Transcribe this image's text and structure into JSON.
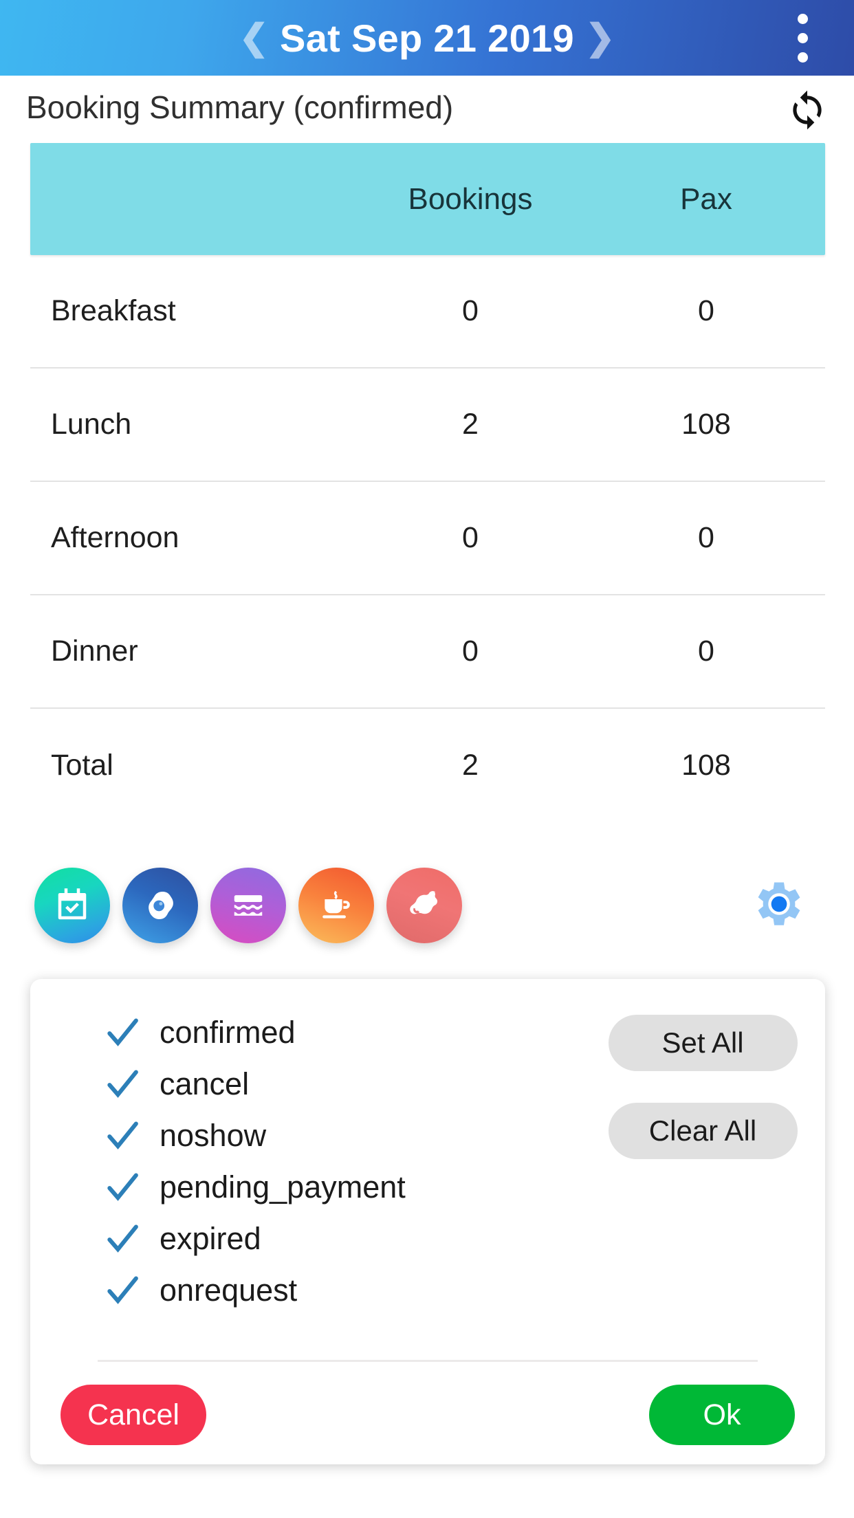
{
  "appbar": {
    "prev_label": "❮",
    "date": "Sat Sep 21 2019",
    "next_label": "❯",
    "overflow_name": "more-options"
  },
  "section": {
    "title": "Booking Summary (confirmed)",
    "refresh_name": "refresh-icon"
  },
  "table": {
    "columns": [
      "",
      "Bookings",
      "Pax"
    ],
    "rows": [
      {
        "name": "Breakfast",
        "bookings": "0",
        "pax": "0"
      },
      {
        "name": "Lunch",
        "bookings": "2",
        "pax": "108"
      },
      {
        "name": "Afternoon",
        "bookings": "0",
        "pax": "0"
      },
      {
        "name": "Dinner",
        "bookings": "0",
        "pax": "0"
      },
      {
        "name": "Total",
        "bookings": "2",
        "pax": "108"
      }
    ]
  },
  "meal_icons": [
    {
      "name": "calendar-check-icon",
      "label": "All bookings"
    },
    {
      "name": "fried-egg-icon",
      "label": "Breakfast"
    },
    {
      "name": "sandwich-icon",
      "label": "Lunch"
    },
    {
      "name": "coffee-cup-icon",
      "label": "Afternoon"
    },
    {
      "name": "chicken-leg-icon",
      "label": "Dinner"
    }
  ],
  "settings": {
    "name": "gear-icon"
  },
  "dialog": {
    "options": [
      {
        "label": "confirmed",
        "checked": true
      },
      {
        "label": "cancel",
        "checked": true
      },
      {
        "label": "noshow",
        "checked": true
      },
      {
        "label": "pending_payment",
        "checked": true
      },
      {
        "label": "expired",
        "checked": true
      },
      {
        "label": "onrequest",
        "checked": true
      }
    ],
    "set_all": "Set All",
    "clear_all": "Clear All",
    "cancel": "Cancel",
    "ok": "Ok"
  },
  "colors": {
    "appbar_start": "#3FB7F1",
    "appbar_end": "#2E4CA8",
    "table_header": "#7FDCE7",
    "check": "#2C7FB8",
    "cancel": "#F5334F",
    "ok": "#00B836",
    "pill": "#E0E0E0"
  }
}
